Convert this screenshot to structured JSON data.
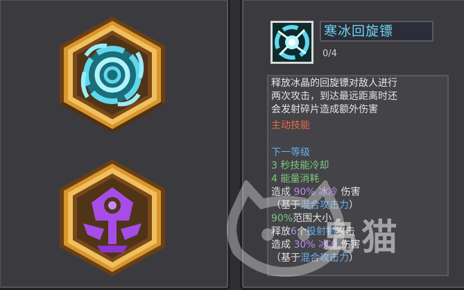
{
  "skill": {
    "name": "寒冰回旋镖",
    "level": "0/4",
    "description": [
      "释放冰晶的回旋镖对敌人进行",
      "两次攻击，到达最远距离时还",
      "会发射碎片造成额外伤害"
    ],
    "type_label": "主动技能"
  },
  "next_level": {
    "header": "下一等级",
    "cooldown": "3 秒技能冷却",
    "energy": "4 能量消耗",
    "dmg1_pre": "造成 ",
    "dmg1_pct": "90% 冰冷",
    "dmg1_post": " 伤害",
    "basis1_pre": "（基于",
    "basis1_link": "混合攻击力",
    "basis1_post": "）",
    "area_pct": "90%",
    "area_label": "范围大小",
    "proj_pre": "释放",
    "proj_num": "6",
    "proj_mid": "个",
    "proj_link": "投射物",
    "proj_post": "攻击",
    "dmg2_pre": "造成 ",
    "dmg2_pct": "30% 冰冷",
    "dmg2_post": " 伤害",
    "basis2_pre": "（基于",
    "basis2_link": "混合攻击力",
    "basis2_post": "）"
  },
  "watermark": {
    "text": "岛猫"
  },
  "colors": {
    "skill_name": "#6fd4ec",
    "green": "#7ec980",
    "blue": "#6aaee6",
    "purple": "#b88ce8",
    "orange": "#ec6a42",
    "badge_gold": "#d9962c",
    "ice": "#5fd8ee",
    "void": "#a64de8"
  },
  "icons": [
    "ice-vortex-icon",
    "void-sigil-icon",
    "skill-icon",
    "cat-watermark-icon"
  ]
}
